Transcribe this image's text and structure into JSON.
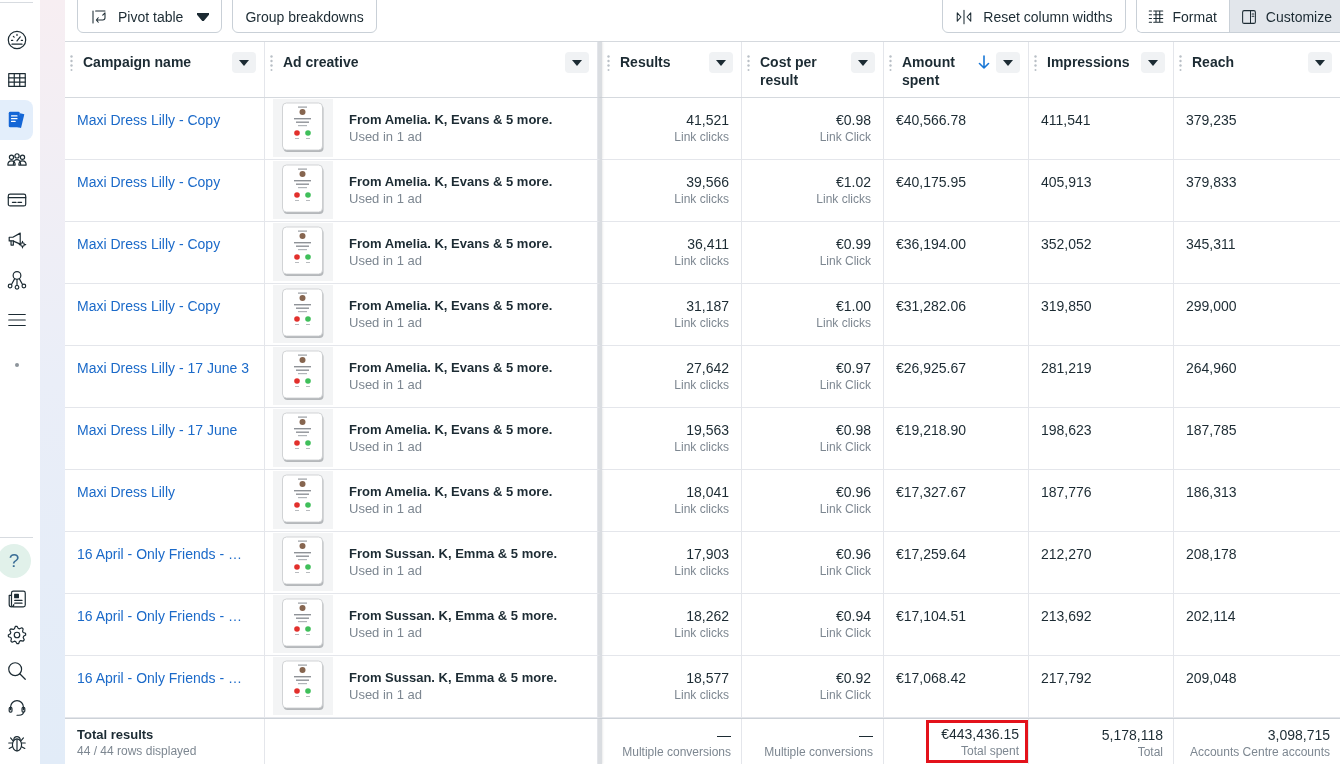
{
  "sidebar": {
    "items": [
      {
        "selected": false
      },
      {
        "selected": false
      },
      {
        "selected": true
      },
      {
        "selected": false
      },
      {
        "selected": false
      },
      {
        "selected": false
      },
      {
        "selected": false
      },
      {
        "selected": false
      }
    ],
    "help": {
      "label": "?"
    }
  },
  "toolbar": {
    "pivot_button": {
      "label": "Pivot table"
    },
    "group_breakdowns_button": {
      "label": "Group breakdowns"
    },
    "reset_widths_button": {
      "label": "Reset column widths"
    },
    "view_toggle": [
      {
        "label": "Format",
        "selected": false
      },
      {
        "label": "Customize",
        "selected": true
      }
    ]
  },
  "table": {
    "columns": [
      {
        "label": "Campaign name",
        "sorted": false
      },
      {
        "label": "Ad creative",
        "sorted": false
      },
      {
        "label": "Results",
        "sorted": false
      },
      {
        "label": "Cost per result",
        "sorted": false
      },
      {
        "label": "Amount spent",
        "sorted": true
      },
      {
        "label": "Impressions",
        "sorted": false
      },
      {
        "label": "Reach",
        "sorted": false
      }
    ],
    "rows": [
      {
        "campaign": "Maxi Dress Lilly - Copy",
        "creative_title": "From Amelia. K, Evans & 5 more.",
        "creative_usage": "Used in 1 ad",
        "results": "41,521",
        "results_unit": "Link clicks",
        "cost": "€0.98",
        "cost_unit": "Link Click",
        "amount": "€40,566.78",
        "impressions": "411,541",
        "reach": "379,235"
      },
      {
        "campaign": "Maxi Dress Lilly - Copy",
        "creative_title": "From Amelia. K, Evans & 5 more.",
        "creative_usage": "Used in 1 ad",
        "results": "39,566",
        "results_unit": "Link clicks",
        "cost": "€1.02",
        "cost_unit": "Link clicks",
        "amount": "€40,175.95",
        "impressions": "405,913",
        "reach": "379,833"
      },
      {
        "campaign": "Maxi Dress Lilly - Copy",
        "creative_title": "From Amelia. K, Evans & 5 more.",
        "creative_usage": "Used in 1 ad",
        "results": "36,411",
        "results_unit": "Link clicks",
        "cost": "€0.99",
        "cost_unit": "Link Click",
        "amount": "€36,194.00",
        "impressions": "352,052",
        "reach": "345,311"
      },
      {
        "campaign": "Maxi Dress Lilly - Copy",
        "creative_title": "From Amelia. K, Evans & 5 more.",
        "creative_usage": "Used in 1 ad",
        "results": "31,187",
        "results_unit": "Link clicks",
        "cost": "€1.00",
        "cost_unit": "Link clicks",
        "amount": "€31,282.06",
        "impressions": "319,850",
        "reach": "299,000"
      },
      {
        "campaign": "Maxi Dress Lilly - 17 June 3",
        "creative_title": "From Amelia. K, Evans & 5 more.",
        "creative_usage": "Used in 1 ad",
        "results": "27,642",
        "results_unit": "Link clicks",
        "cost": "€0.97",
        "cost_unit": "Link Click",
        "amount": "€26,925.67",
        "impressions": "281,219",
        "reach": "264,960"
      },
      {
        "campaign": "Maxi Dress Lilly - 17 June",
        "creative_title": "From Amelia. K, Evans & 5 more.",
        "creative_usage": "Used in 1 ad",
        "results": "19,563",
        "results_unit": "Link clicks",
        "cost": "€0.98",
        "cost_unit": "Link Click",
        "amount": "€19,218.90",
        "impressions": "198,623",
        "reach": "187,785"
      },
      {
        "campaign": "Maxi Dress Lilly",
        "creative_title": "From Amelia. K, Evans & 5 more.",
        "creative_usage": "Used in 1 ad",
        "results": "18,041",
        "results_unit": "Link clicks",
        "cost": "€0.96",
        "cost_unit": "Link Click",
        "amount": "€17,327.67",
        "impressions": "187,776",
        "reach": "186,313"
      },
      {
        "campaign": "16 April - Only Friends - …",
        "creative_title": "From Sussan. K, Emma & 5 more.",
        "creative_usage": "Used in 1 ad",
        "results": "17,903",
        "results_unit": "Link clicks",
        "cost": "€0.96",
        "cost_unit": "Link Click",
        "amount": "€17,259.64",
        "impressions": "212,270",
        "reach": "208,178"
      },
      {
        "campaign": "16 April - Only Friends - …",
        "creative_title": "From Sussan. K, Emma & 5 more.",
        "creative_usage": "Used in 1 ad",
        "results": "18,262",
        "results_unit": "Link clicks",
        "cost": "€0.94",
        "cost_unit": "Link Click",
        "amount": "€17,104.51",
        "impressions": "213,692",
        "reach": "202,114"
      },
      {
        "campaign": "16 April - Only Friends - …",
        "creative_title": "From Sussan. K, Emma & 5 more.",
        "creative_usage": "Used in 1 ad",
        "results": "18,577",
        "results_unit": "Link clicks",
        "cost": "€0.92",
        "cost_unit": "Link Click",
        "amount": "€17,068.42",
        "impressions": "217,792",
        "reach": "209,048"
      }
    ],
    "totals": {
      "label": "Total results",
      "rows_displayed": "44 / 44 rows displayed",
      "cells": [
        {
          "value": "—",
          "caption": "Multiple conversions",
          "highlighted": false
        },
        {
          "value": "—",
          "caption": "Multiple conversions",
          "highlighted": false
        },
        {
          "value": "€443,436.15",
          "caption": "Total spent",
          "highlighted": true
        },
        {
          "value": "5,178,118",
          "caption": "Total",
          "highlighted": false
        },
        {
          "value": "3,098,715",
          "caption": "Accounts Centre accounts",
          "highlighted": false
        }
      ]
    }
  }
}
